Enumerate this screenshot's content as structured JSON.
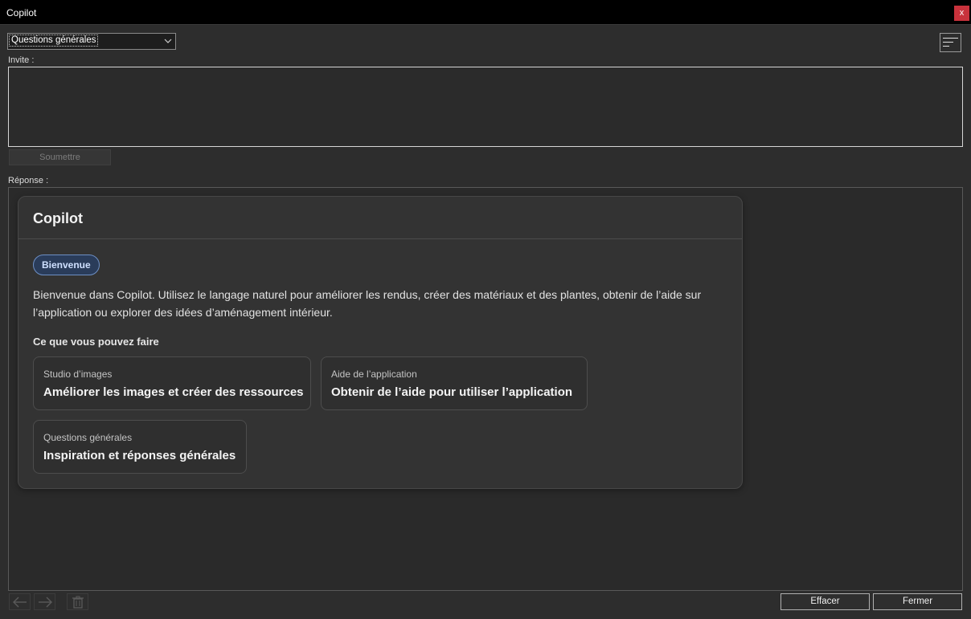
{
  "window": {
    "title": "Copilot",
    "close_label": "x"
  },
  "mode_select": {
    "selected": "Questions générales"
  },
  "prompt": {
    "label": "Invite :",
    "value": "",
    "submit_label": "Soumettre"
  },
  "response": {
    "label": "Réponse :",
    "card": {
      "title": "Copilot",
      "badge": "Bienvenue",
      "intro": "Bienvenue dans Copilot. Utilisez le langage naturel pour améliorer les rendus, créer des matériaux et des plantes, obtenir de l’aide sur l’application ou explorer des idées d’aménagement intérieur.",
      "section_heading": "Ce que vous pouvez faire",
      "options": [
        {
          "category": "Studio d’images",
          "title": "Améliorer les images et créer des ressources"
        },
        {
          "category": "Aide de l’application",
          "title": "Obtenir de l’aide pour utiliser l’application"
        },
        {
          "category": "Questions générales",
          "title": "Inspiration et réponses générales"
        }
      ]
    }
  },
  "footer": {
    "back_icon": "arrow-left-icon",
    "forward_icon": "arrow-right-icon",
    "delete_icon": "trash-icon",
    "clear_label": "Effacer",
    "close_label": "Fermer"
  },
  "colors": {
    "background": "#2d2d2d",
    "titlebar": "#000000",
    "close_button": "#c8323c",
    "badge_border": "#6d8fc4",
    "badge_fill": "#2a3c5a"
  }
}
